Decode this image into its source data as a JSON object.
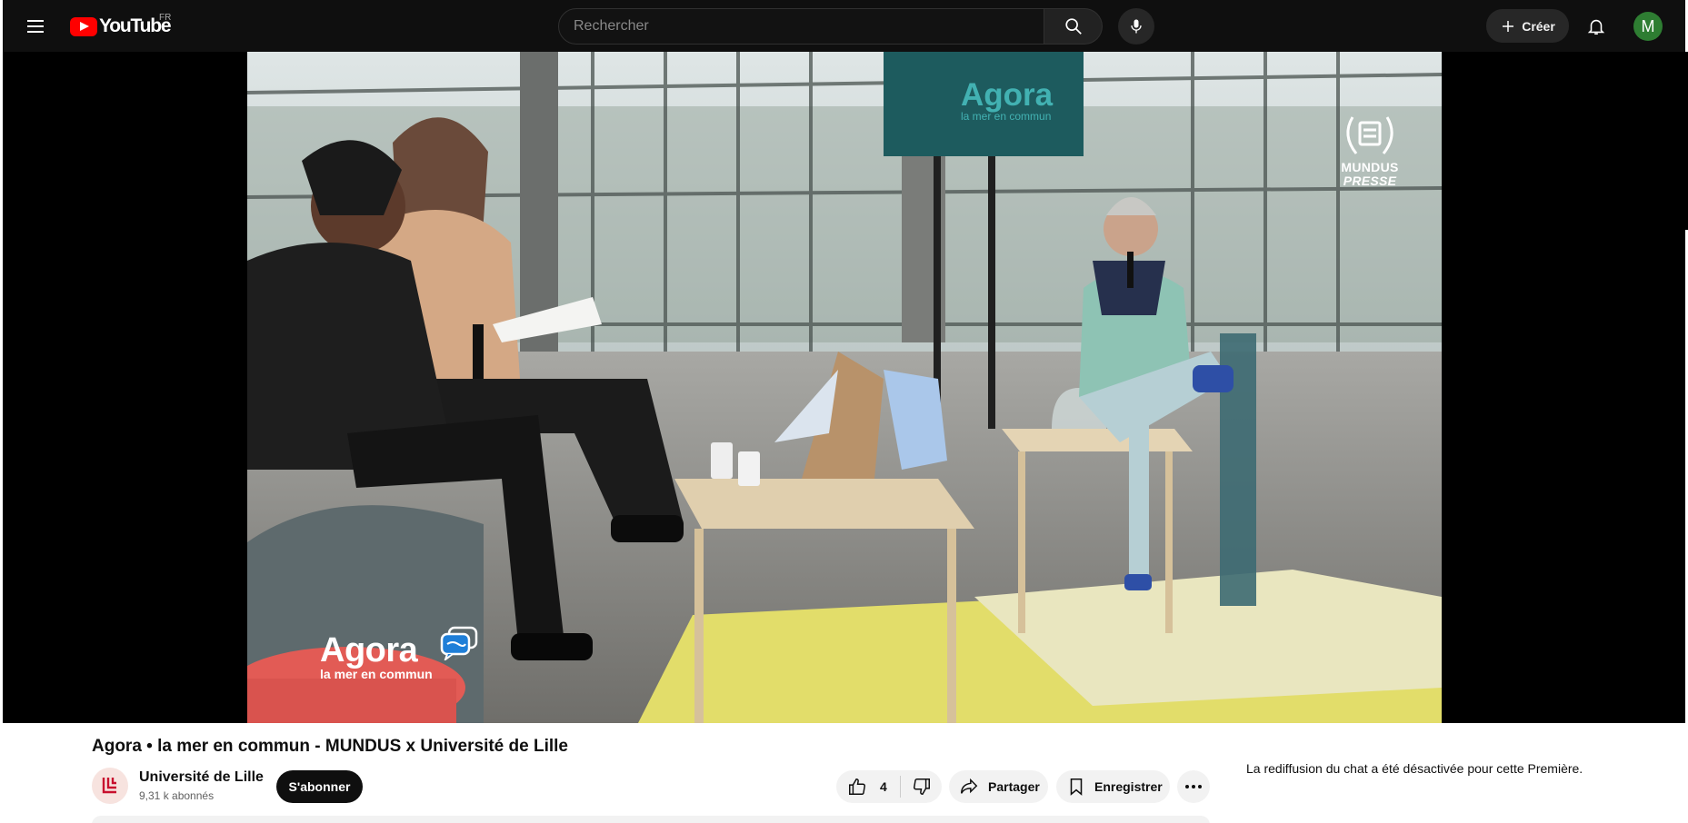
{
  "masthead": {
    "logo_text": "YouTube",
    "country_code": "FR",
    "search_placeholder": "Rechercher",
    "create_label": "Créer",
    "avatar_initial": "M"
  },
  "player": {
    "overlay_left_logo": {
      "word": "Agora",
      "tagline": "la mer en commun"
    },
    "overlay_right_logo": {
      "line1": "MUNDUS",
      "line2": "PRESSE"
    },
    "background_screen": {
      "word": "Agora",
      "tagline": "la mer en commun"
    }
  },
  "video": {
    "title": "Agora • la mer en commun - MUNDUS x Université de Lille"
  },
  "channel": {
    "name": "Université de Lille",
    "subscribers": "9,31 k abonnés",
    "subscribe_label": "S'abonner"
  },
  "actions": {
    "like_count": "4",
    "share_label": "Partager",
    "save_label": "Enregistrer"
  },
  "chat": {
    "replay_disabled_message": "La rediffusion du chat a été désactivée pour cette Première."
  },
  "colors": {
    "masthead_bg": "#0f0f0f",
    "youtube_red": "#ff0000",
    "avatar_green": "#2e7d32",
    "university_red": "#c8102e"
  }
}
